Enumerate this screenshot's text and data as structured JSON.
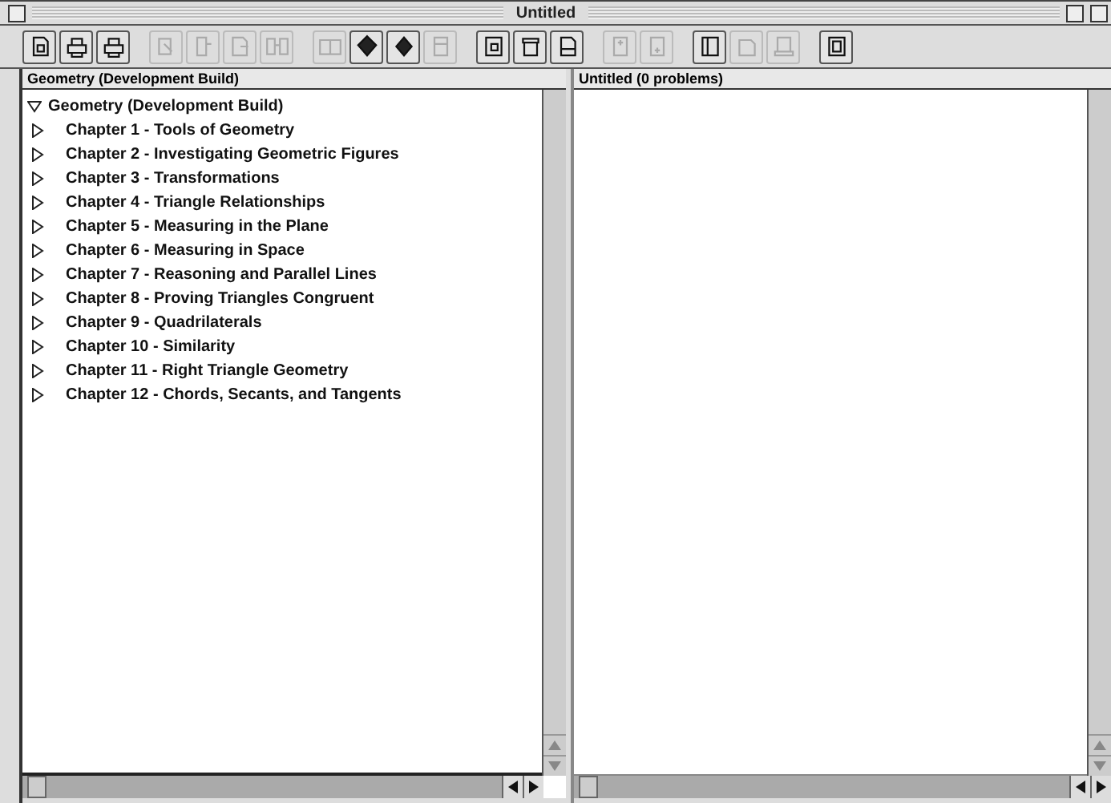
{
  "window": {
    "title": "Untitled"
  },
  "toolbar": {
    "groups": [
      [
        {
          "disabled": false
        },
        {
          "disabled": false
        },
        {
          "disabled": false
        }
      ],
      [
        {
          "disabled": true
        },
        {
          "disabled": true
        },
        {
          "disabled": true
        },
        {
          "disabled": true
        }
      ],
      [
        {
          "disabled": true
        },
        {
          "disabled": false
        },
        {
          "disabled": false
        },
        {
          "disabled": true
        }
      ],
      [
        {
          "disabled": false
        },
        {
          "disabled": false
        },
        {
          "disabled": false
        }
      ],
      [
        {
          "disabled": true
        },
        {
          "disabled": true
        }
      ],
      [
        {
          "disabled": false
        },
        {
          "disabled": true
        },
        {
          "disabled": true
        }
      ],
      [
        {
          "disabled": false
        }
      ]
    ]
  },
  "left_pane": {
    "header": "Geometry (Development Build)",
    "tree": [
      {
        "label": "Geometry (Development Build)",
        "expanded": true,
        "children": [
          {
            "label": "Chapter 1 - Tools of Geometry",
            "expanded": false
          },
          {
            "label": "Chapter 2 - Investigating Geometric Figures",
            "expanded": false
          },
          {
            "label": "Chapter 3 - Transformations",
            "expanded": false
          },
          {
            "label": "Chapter 4 - Triangle Relationships",
            "expanded": false
          },
          {
            "label": "Chapter 5 - Measuring in the Plane",
            "expanded": false
          },
          {
            "label": "Chapter 6 - Measuring in Space",
            "expanded": false
          },
          {
            "label": "Chapter 7 - Reasoning and Parallel Lines",
            "expanded": false
          },
          {
            "label": "Chapter 8 - Proving Triangles Congruent",
            "expanded": false
          },
          {
            "label": "Chapter 9 - Quadrilaterals",
            "expanded": false
          },
          {
            "label": "Chapter 10 - Similarity",
            "expanded": false
          },
          {
            "label": "Chapter 11 - Right Triangle Geometry",
            "expanded": false
          },
          {
            "label": "Chapter 12 - Chords, Secants, and Tangents",
            "expanded": false
          }
        ]
      }
    ]
  },
  "right_pane": {
    "header": "Untitled (0 problems)"
  }
}
